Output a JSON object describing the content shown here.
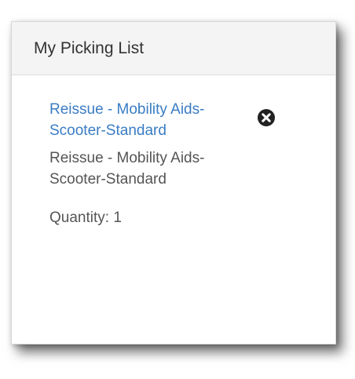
{
  "panel": {
    "title": "My Picking List"
  },
  "item": {
    "link_text": "Reissue - Mobility Aids-Scooter-Standard",
    "description": "Reissue - Mobility Aids-Scooter-Standard",
    "quantity": "Quantity: 1",
    "remove_icon": "close-circle-icon"
  },
  "colors": {
    "link": "#3a7cc4",
    "text": "#555555",
    "header_bg": "#f4f4f4"
  }
}
